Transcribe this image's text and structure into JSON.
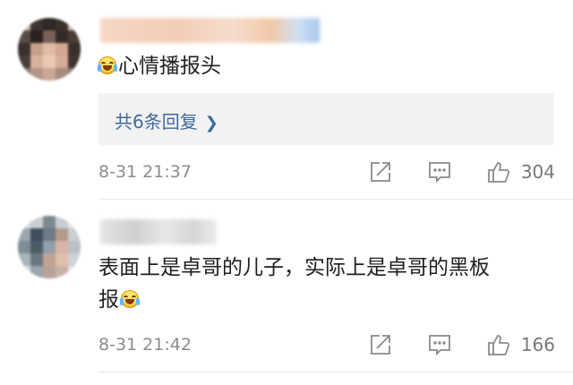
{
  "comments": [
    {
      "text": "心情播报头",
      "reply_link": "共6条回复",
      "timestamp": "8-31 21:37",
      "likes": "304"
    },
    {
      "text_line1": "表面上是卓哥的儿子，实际上是卓哥的黑板",
      "text_line2": "报",
      "timestamp": "8-31 21:42",
      "likes": "166"
    }
  ],
  "icons": {
    "emoji": "laughing-tears-emoji-icon",
    "share": "share-icon",
    "comment": "comment-icon",
    "like": "thumbs-up-icon"
  },
  "colors": {
    "link": "#3f6a9c",
    "meta": "#8c8c8c",
    "reply_bg": "#f2f2f2"
  }
}
